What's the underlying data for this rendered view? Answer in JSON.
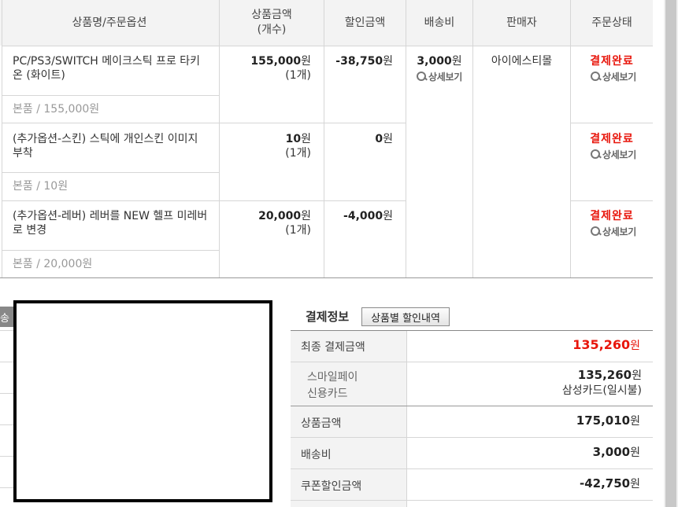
{
  "table": {
    "headers": {
      "product": "상품명/주문옵션",
      "price_line1": "상품금액",
      "price_line2": "(개수)",
      "discount": "할인금액",
      "shipping": "배송비",
      "seller": "판매자",
      "status": "주문상태"
    },
    "rows": [
      {
        "name": "PC/PS3/SWITCH 메이크스틱 프로 타키온 (화이트)",
        "price": "155,000",
        "qty": "(1개)",
        "discount": "-38,750",
        "sub": "본품 / 155,000원",
        "status": "결제완료",
        "detail": "상세보기"
      },
      {
        "name": "(추가옵션-스킨) 스틱에 개인스킨 이미지 부착",
        "price": "10",
        "qty": "(1개)",
        "discount": "0",
        "sub": "본품 / 10원",
        "status": "결제완료",
        "detail": "상세보기"
      },
      {
        "name": "(추가옵션-레버) 레버를 NEW 헬프 미레버로 변경",
        "price": "20,000",
        "qty": "(1개)",
        "discount": "-4,000",
        "sub": "본품 / 20,000원",
        "status": "결제완료",
        "detail": "상세보기"
      }
    ],
    "shipping_fee": "3,000",
    "shipping_detail": "상세보기",
    "seller": "아이에스티몰",
    "won": "원"
  },
  "payment": {
    "title": "결제정보",
    "discount_button": "상품별 할인내역",
    "final_label": "최종 결제금액",
    "final_value": "135,260",
    "method_line1": "스마일페이",
    "method_line2": "신용카드",
    "method_value": "135,260",
    "method_detail": "삼성카드(일시불)",
    "product_label": "상품금액",
    "product_value": "175,010",
    "shipping_label": "배송비",
    "shipping_value": "3,000",
    "coupon_label": "쿠폰할인금액",
    "coupon_value": "-42,750",
    "won": "원"
  },
  "left_tab_text": "배송",
  "colors": {
    "accent_red": "#e8160c",
    "header_bg": "#f3f3f3",
    "border": "#d6d6d6"
  }
}
